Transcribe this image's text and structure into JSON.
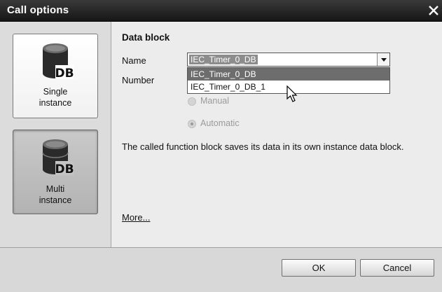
{
  "window": {
    "title": "Call options"
  },
  "instance_options": [
    {
      "icon_text": "DB",
      "label_line1": "Single",
      "label_line2": "instance",
      "selected": false
    },
    {
      "icon_text": "DB",
      "label_line1": "Multi",
      "label_line2": "instance",
      "selected": true
    }
  ],
  "data_block": {
    "section_title": "Data block",
    "name_label": "Name",
    "name_value": "IEC_Timer_0_DB",
    "number_label": "Number",
    "dropdown_options": [
      "IEC_Timer_0_DB",
      "IEC_Timer_0_DB_1"
    ],
    "radio_manual": "Manual",
    "radio_automatic": "Automatic"
  },
  "description": "The called function block saves its data in its own instance data block.",
  "more_link": "More...",
  "buttons": {
    "ok": "OK",
    "cancel": "Cancel"
  }
}
